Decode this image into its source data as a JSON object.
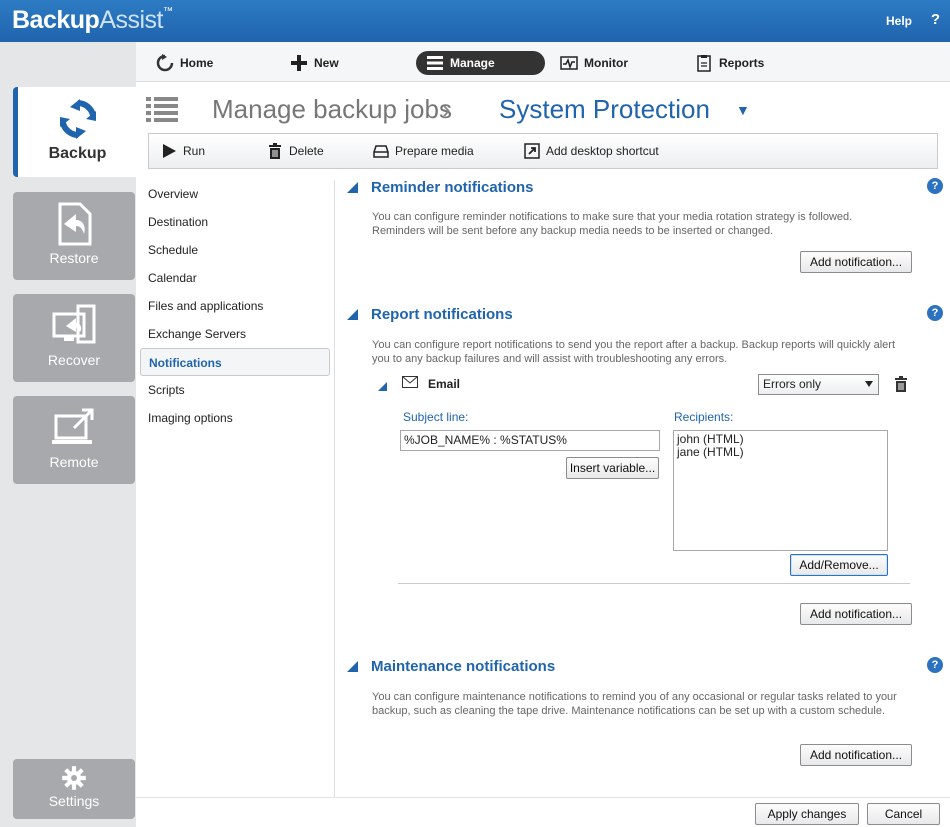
{
  "app": {
    "logo_main": "Backup",
    "logo_accent": "Assist",
    "logo_tm": "™",
    "help_label": "Help",
    "help_icon": "?"
  },
  "left_nav": [
    {
      "label": "Backup",
      "icon": "refresh-icon",
      "active": true
    },
    {
      "label": "Restore",
      "icon": "restore-icon",
      "active": false
    },
    {
      "label": "Recover",
      "icon": "recover-icon",
      "active": false
    },
    {
      "label": "Remote",
      "icon": "remote-icon",
      "active": false
    },
    {
      "label": "Settings",
      "icon": "gear-icon",
      "active": false
    }
  ],
  "toolbar": {
    "home": "Home",
    "new": "New",
    "manage": "Manage",
    "monitor": "Monitor",
    "reports": "Reports"
  },
  "breadcrumb": {
    "parent": "Manage backup jobs",
    "separator": "›",
    "current": "System Protection"
  },
  "actions": {
    "run": "Run",
    "delete": "Delete",
    "prepare_media": "Prepare media",
    "add_shortcut": "Add desktop shortcut"
  },
  "subnav": [
    {
      "label": "Overview",
      "selected": false
    },
    {
      "label": "Destination",
      "selected": false
    },
    {
      "label": "Schedule",
      "selected": false
    },
    {
      "label": "Calendar",
      "selected": false
    },
    {
      "label": "Files and applications",
      "selected": false
    },
    {
      "label": "Exchange Servers",
      "selected": false
    },
    {
      "label": "Notifications",
      "selected": true
    },
    {
      "label": "Scripts",
      "selected": false
    },
    {
      "label": "Imaging options",
      "selected": false
    }
  ],
  "reminder": {
    "title": "Reminder notifications",
    "description": "You can configure reminder notifications to make sure that your media rotation strategy is followed. Reminders will be sent before any backup media needs to be inserted or changed.",
    "add_button": "Add notification..."
  },
  "report": {
    "title": "Report notifications",
    "description": "You can configure report notifications to send you the report after a backup.  Backup reports will quickly alert you to any backup failures and will assist with troubleshooting any errors.",
    "email": {
      "label": "Email",
      "condition": "Errors only",
      "subject_label": "Subject line:",
      "subject_value": "%JOB_NAME% : %STATUS%",
      "insert_variable": "Insert variable...",
      "recipients_label": "Recipients:",
      "recipients": [
        "john (HTML)",
        "jane (HTML)"
      ],
      "add_remove": "Add/Remove..."
    },
    "add_button": "Add notification..."
  },
  "maintenance": {
    "title": "Maintenance notifications",
    "description": "You can configure maintenance notifications to remind you of any occasional or regular tasks related to your backup, such as cleaning the tape drive.  Maintenance notifications can be set up with a custom schedule.",
    "add_button": "Add notification..."
  },
  "footer": {
    "apply": "Apply changes",
    "cancel": "Cancel"
  },
  "colors": {
    "accent": "#1f64ad",
    "titlebar": "#2d7bc4",
    "nav_inactive": "#a7a9ac"
  }
}
